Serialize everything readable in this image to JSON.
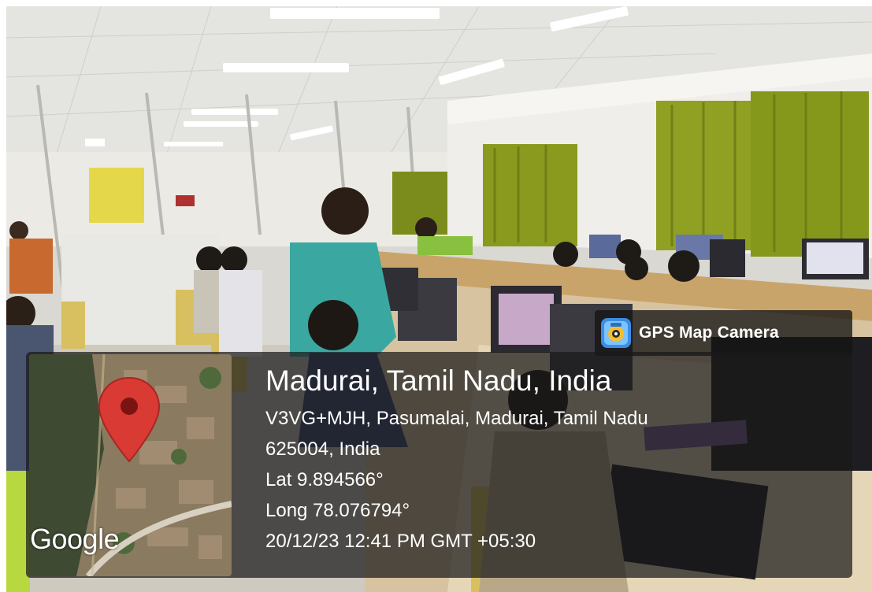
{
  "watermark": {
    "app_name": "GPS Map Camera",
    "icon": "gps-map-camera-app-icon"
  },
  "map_thumbnail": {
    "provider_logo": "Google",
    "marker_icon": "map-pin-icon",
    "marker_color": "#d93a34"
  },
  "location": {
    "city_line": "Madurai, Tamil Nadu, India",
    "address_line_1": "V3VG+MJH, Pasumalai, Madurai, Tamil Nadu",
    "address_line_2": "625004, India",
    "latitude": "Lat 9.894566°",
    "longitude": "Long 78.076794°",
    "timestamp": "20/12/23 12:41 PM GMT +05:30"
  },
  "colors": {
    "overlay": "#1a1a1a",
    "text": "#ffffff",
    "curtain": "#8a9a1e"
  }
}
